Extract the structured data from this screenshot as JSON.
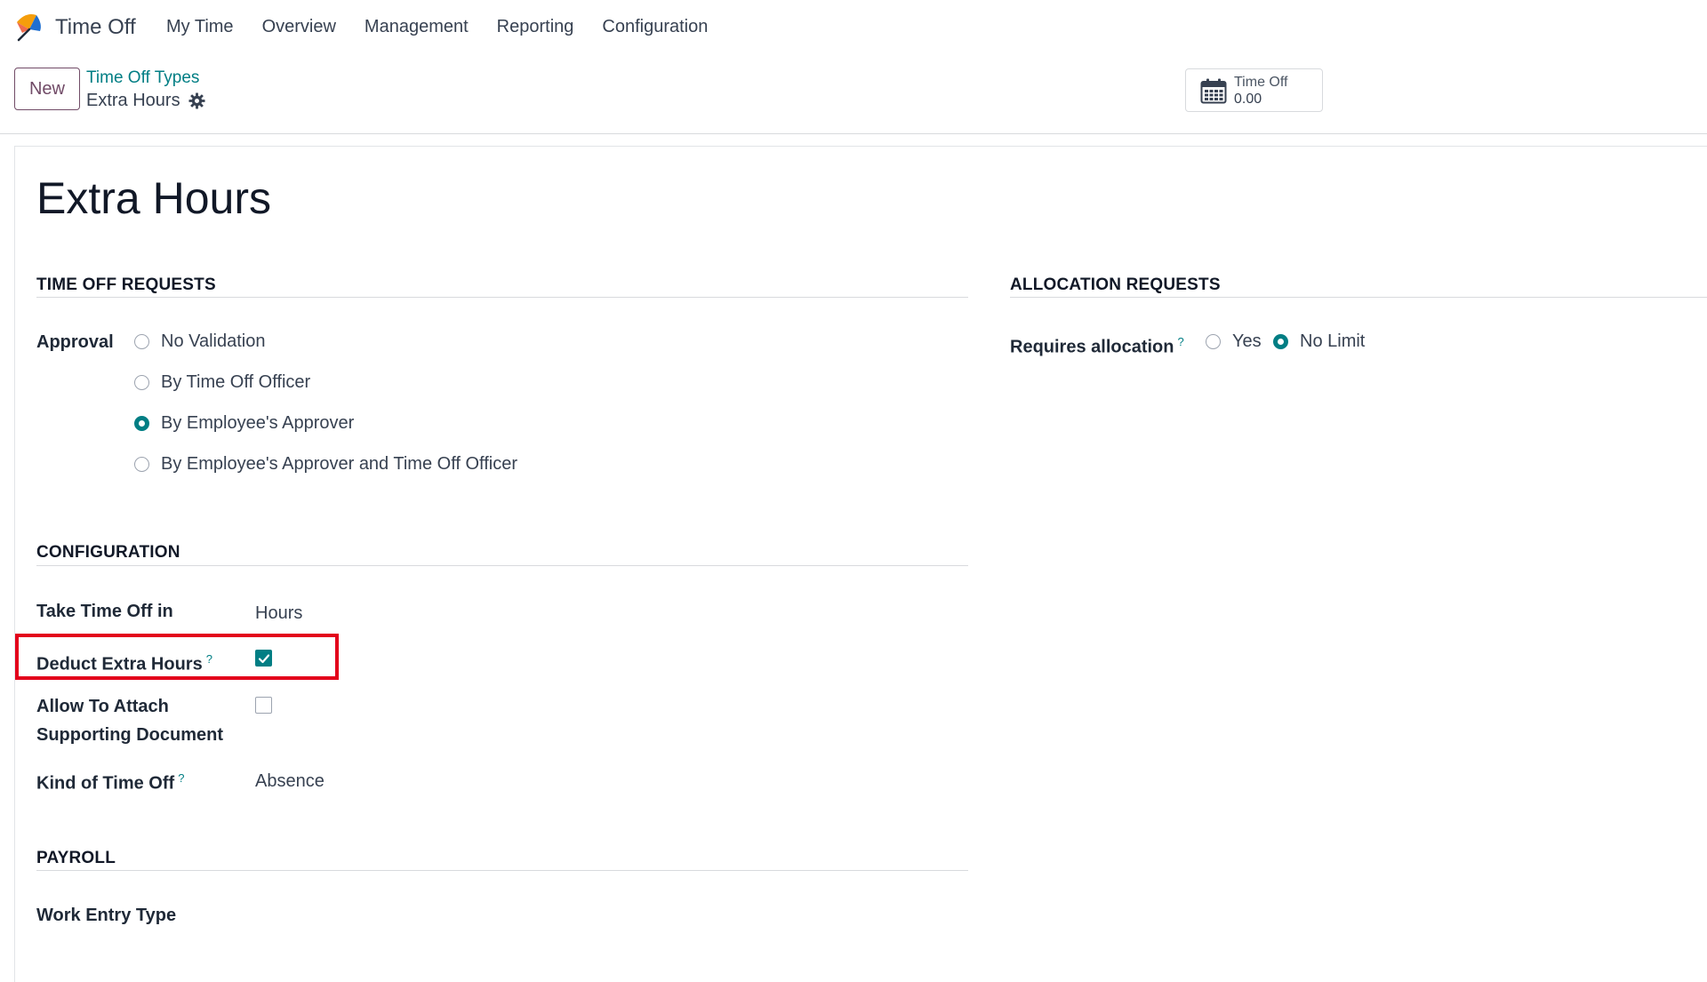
{
  "app": {
    "name": "Time Off",
    "menu": [
      "My Time",
      "Overview",
      "Management",
      "Reporting",
      "Configuration"
    ]
  },
  "control_panel": {
    "new_label": "New",
    "breadcrumb_parent": "Time Off Types",
    "breadcrumb_current": "Extra Hours",
    "stat_button": {
      "label": "Time Off",
      "value": "0.00"
    }
  },
  "record": {
    "title": "Extra Hours"
  },
  "time_off_requests": {
    "title": "TIME OFF REQUESTS",
    "approval_label": "Approval",
    "options": [
      {
        "label": "No Validation",
        "selected": false
      },
      {
        "label": "By Time Off Officer",
        "selected": false
      },
      {
        "label": "By Employee's Approver",
        "selected": true
      },
      {
        "label": "By Employee's Approver and Time Off Officer",
        "selected": false
      }
    ]
  },
  "allocation_requests": {
    "title": "ALLOCATION REQUESTS",
    "requires_allocation_label": "Requires allocation",
    "options": [
      {
        "label": "Yes",
        "selected": false
      },
      {
        "label": "No Limit",
        "selected": true
      }
    ]
  },
  "configuration": {
    "title": "CONFIGURATION",
    "take_time_off_in_label": "Take Time Off in",
    "take_time_off_in_value": "Hours",
    "deduct_extra_hours_label": "Deduct Extra Hours",
    "deduct_extra_hours_checked": true,
    "allow_attach_label_line1": "Allow To Attach",
    "allow_attach_label_line2": "Supporting Document",
    "allow_attach_checked": false,
    "kind_label": "Kind of Time Off",
    "kind_value": "Absence"
  },
  "payroll": {
    "title": "PAYROLL",
    "work_entry_type_label": "Work Entry Type"
  },
  "help_mark": "?",
  "colors": {
    "accent": "#017e84",
    "brand": "#714b67",
    "highlight": "#e3001b"
  }
}
